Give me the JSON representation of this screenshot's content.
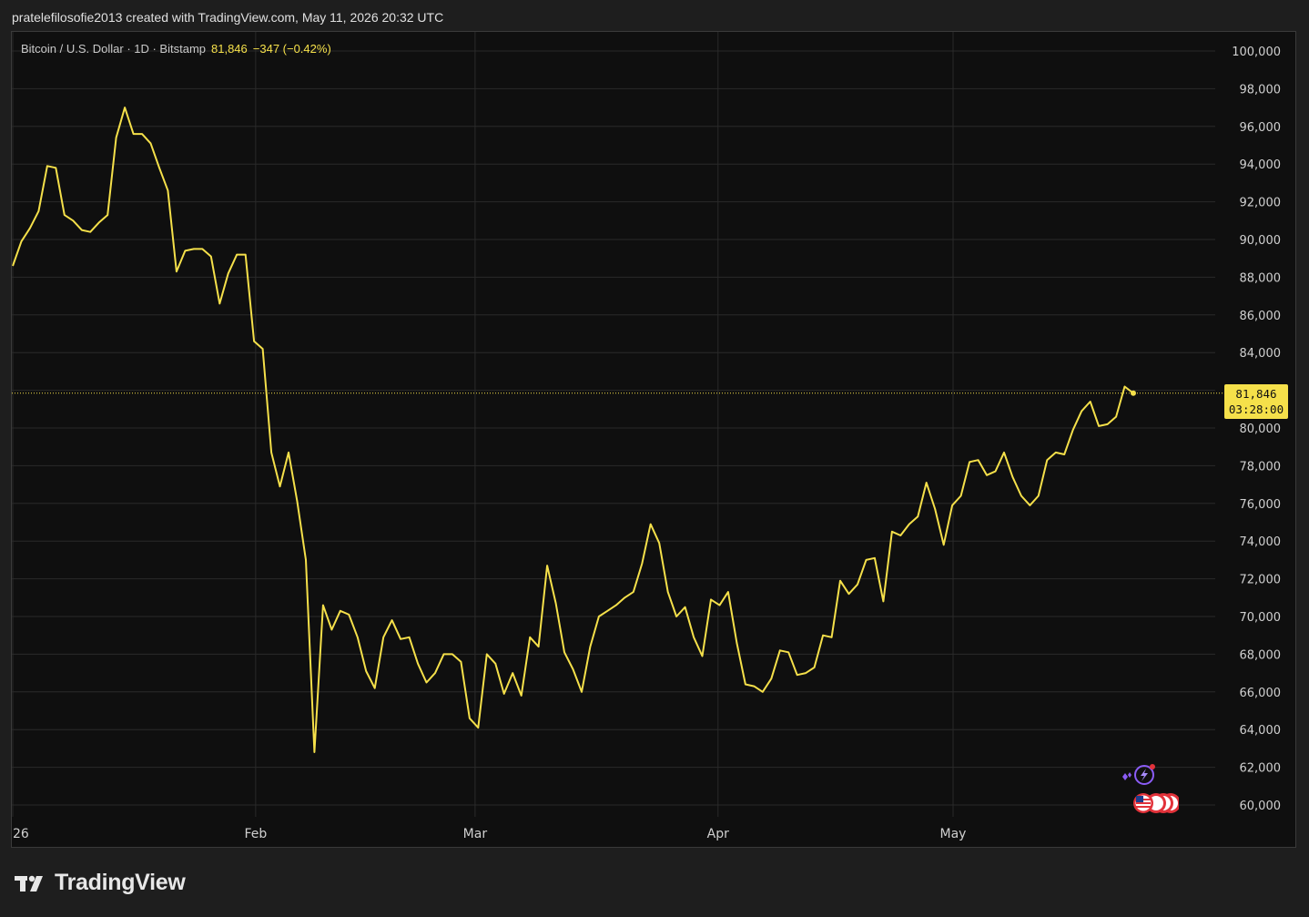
{
  "header": {
    "attribution": "pratelefilosofie2013 created with TradingView.com, May 11, 2026 20:32 UTC"
  },
  "legend": {
    "symbol": "Bitcoin / U.S. Dollar · 1D · Bitstamp",
    "last_price": "81,846",
    "change": "−347 (−0.42%)"
  },
  "price_tag": {
    "price": "81,846",
    "countdown": "03:28:00"
  },
  "brand": {
    "name": "TradingView"
  },
  "icons": {
    "brand_logo": "tradingview-logo-icon",
    "ai_insight": "sparkle-lightning-icon",
    "economic_events": "us-flag-event-icon"
  },
  "colors": {
    "background": "#0f0f0f",
    "line": "#f5e04a",
    "grid": "#2a2a2a",
    "axis_text": "#d0d0d0",
    "event_ring": "#e2323a",
    "ai_icon": "#8b5cf6"
  },
  "chart_data": {
    "type": "line",
    "title": "",
    "xlabel": "",
    "ylabel": "",
    "ylim": [
      59000,
      101500
    ],
    "y_ticks": [
      60000,
      62000,
      64000,
      66000,
      68000,
      70000,
      72000,
      74000,
      76000,
      78000,
      80000,
      82000,
      84000,
      86000,
      88000,
      90000,
      92000,
      94000,
      96000,
      98000,
      100000
    ],
    "y_tick_labels": [
      "60,000",
      "62,000",
      "64,000",
      "66,000",
      "68,000",
      "70,000",
      "72,000",
      "74,000",
      "76,000",
      "78,000",
      "80,000",
      "82,000",
      "84,000",
      "86,000",
      "88,000",
      "90,000",
      "92,000",
      "94,000",
      "96,000",
      "98,000",
      "100,000"
    ],
    "x_ticks": [
      {
        "label": "26",
        "day": 1
      },
      {
        "label": "Feb",
        "day": 32
      },
      {
        "label": "Mar",
        "day": 60
      },
      {
        "label": "Apr",
        "day": 91
      },
      {
        "label": "May",
        "day": 121
      }
    ],
    "x_range_days": [
      1,
      144
    ],
    "current_price": 81846,
    "grid": true,
    "series": [
      {
        "values": [
          88600,
          89900,
          90600,
          91500,
          93900,
          93800,
          91300,
          91000,
          90500,
          90400,
          90900,
          91300,
          95400,
          97000,
          95600,
          95600,
          95100,
          93800,
          92600,
          88300,
          89400,
          89500,
          89500,
          89100,
          86600,
          88200,
          89200,
          89200,
          84600,
          84200,
          78700,
          76900,
          78700,
          76100,
          73000,
          62800,
          70600,
          69300,
          70300,
          70100,
          68900,
          67100,
          66200,
          68900,
          69800,
          68800,
          68900,
          67500,
          66500,
          67000,
          68000,
          68000,
          67600,
          64600,
          64100,
          68000,
          67500,
          65900,
          67000,
          65800,
          68900,
          68400,
          72700,
          70700,
          68100,
          67200,
          66000,
          68400,
          70000,
          70300,
          70600,
          71000,
          71300,
          72800,
          74900,
          73900,
          71300,
          70000,
          70500,
          68900,
          67900,
          70900,
          70600,
          71300,
          68600,
          66400,
          66300,
          66000,
          66700,
          68200,
          68100,
          66900,
          67000,
          67300,
          69000,
          68900,
          71900,
          71200,
          71700,
          73000,
          73100,
          70800,
          74500,
          74300,
          74900,
          75300,
          77100,
          75700,
          73800,
          75900,
          76400,
          78200,
          78300,
          77500,
          77700,
          78700,
          77400,
          76400,
          75900,
          76400,
          78300,
          78700,
          78600,
          79900,
          80900,
          81400,
          80100,
          80200,
          80600,
          82200,
          81846
        ]
      }
    ]
  }
}
